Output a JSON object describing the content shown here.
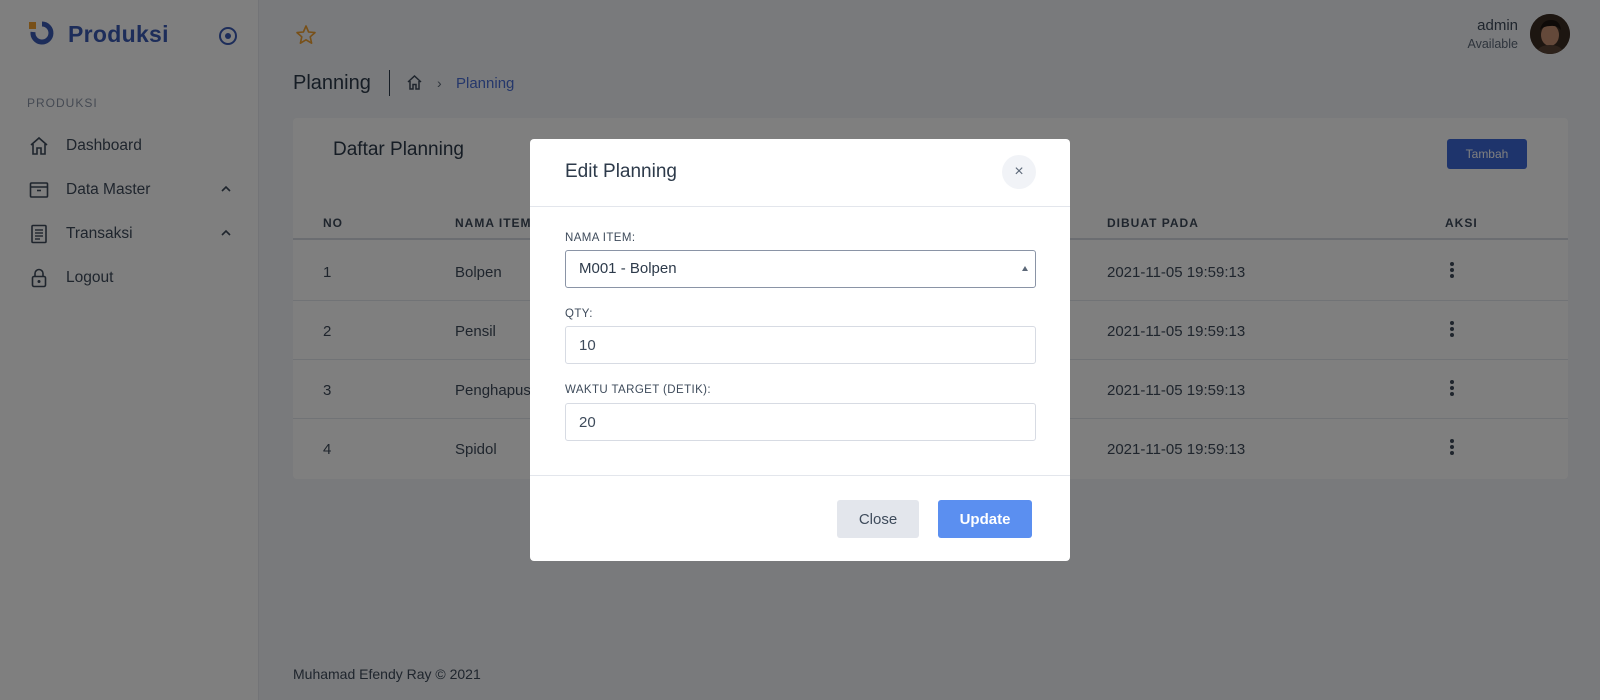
{
  "brand": {
    "name": "Produksi"
  },
  "sidebar": {
    "section_title": "PRODUKSI",
    "items": [
      {
        "label": "Dashboard",
        "icon": "home-icon"
      },
      {
        "label": "Data Master",
        "icon": "archive-icon",
        "expandable": true
      },
      {
        "label": "Transaksi",
        "icon": "document-icon",
        "expandable": true
      },
      {
        "label": "Logout",
        "icon": "lock-icon"
      }
    ]
  },
  "header": {
    "user_name": "admin",
    "user_status": "Available"
  },
  "page": {
    "title": "Planning",
    "breadcrumb_current": "Planning"
  },
  "card": {
    "title": "Daftar Planning",
    "add_button": "Tambah",
    "columns": [
      "NO",
      "NAMA ITEM",
      "DIBUAT PADA",
      "AKSI"
    ],
    "rows": [
      {
        "no": "1",
        "item": "Bolpen",
        "created": "2021-11-05 19:59:13"
      },
      {
        "no": "2",
        "item": "Pensil",
        "created": "2021-11-05 19:59:13"
      },
      {
        "no": "3",
        "item": "Penghapus",
        "created": "2021-11-05 19:59:13"
      },
      {
        "no": "4",
        "item": "Spidol",
        "created": "2021-11-05 19:59:13"
      }
    ]
  },
  "footer": {
    "text": "Muhamad Efendy Ray © 2021"
  },
  "modal": {
    "title": "Edit Planning",
    "close_symbol": "×",
    "nama_item_label": "NAMA ITEM:",
    "nama_item_value": "M001 - Bolpen",
    "qty_label": "QTY:",
    "qty_value": "10",
    "waktu_label": "WAKTU TARGET (DETIK):",
    "waktu_value": "20",
    "close_button": "Close",
    "update_button": "Update"
  },
  "colors": {
    "accent": "#3d68d8",
    "update": "#5b8ff0",
    "logo_orange": "#f0a030"
  }
}
